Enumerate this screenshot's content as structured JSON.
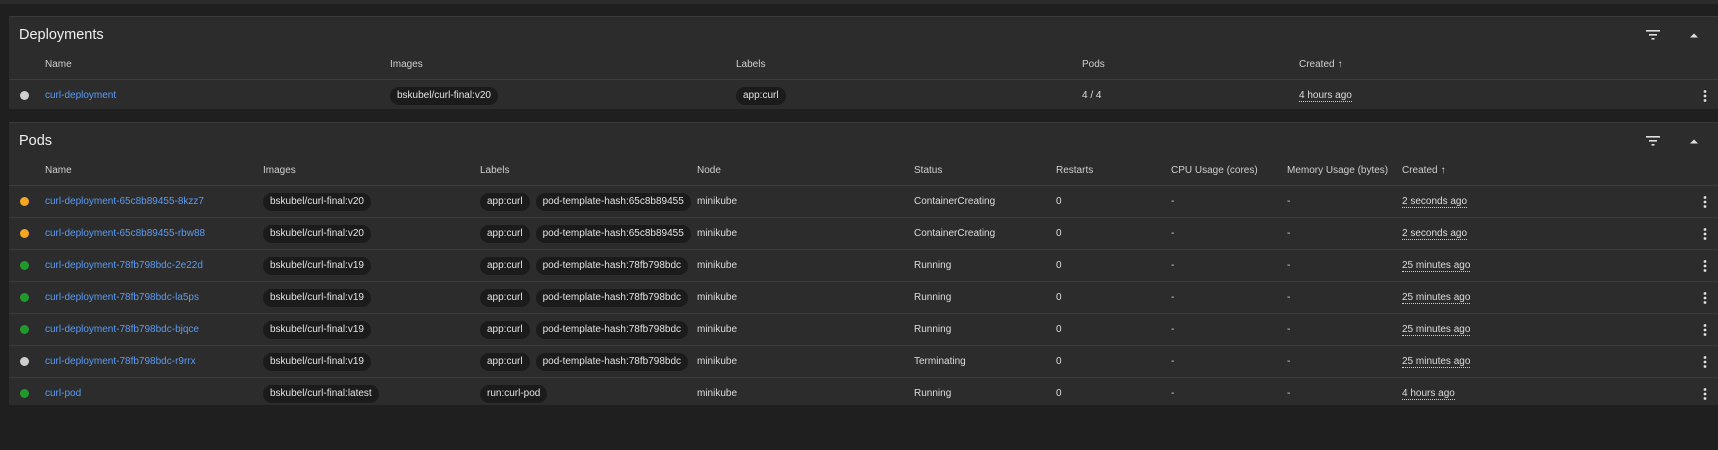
{
  "colors": {
    "running": "#1f9a2c",
    "pending": "#f5a623",
    "terminating": "#cfcfcf",
    "deployment_status": "#cfcfcf",
    "link": "#5b9bf2"
  },
  "deployments": {
    "title": "Deployments",
    "filter_icon": "filter-list-icon",
    "collapse_icon": "chevron-up-icon",
    "columns": {
      "name": "Name",
      "images": "Images",
      "labels": "Labels",
      "pods": "Pods",
      "created": "Created"
    },
    "rows": [
      {
        "status": "deployment_status",
        "name": "curl-deployment",
        "image": "bskubel/curl-final:v20",
        "labels": [
          "app:curl"
        ],
        "pods": "4 / 4",
        "created": "4 hours ago"
      }
    ]
  },
  "pods": {
    "title": "Pods",
    "filter_icon": "filter-list-icon",
    "collapse_icon": "chevron-up-icon",
    "columns": {
      "name": "Name",
      "images": "Images",
      "labels": "Labels",
      "node": "Node",
      "status": "Status",
      "restarts": "Restarts",
      "cpu": "CPU Usage (cores)",
      "memory": "Memory Usage (bytes)",
      "created": "Created"
    },
    "rows": [
      {
        "dot": "pending",
        "name": "curl-deployment-65c8b89455-8kzz7",
        "image": "bskubel/curl-final:v20",
        "labels": [
          "app:curl",
          "pod-template-hash:65c8b89455"
        ],
        "node": "minikube",
        "status": "ContainerCreating",
        "restarts": "0",
        "cpu": "-",
        "memory": "-",
        "created": "2 seconds ago"
      },
      {
        "dot": "pending",
        "name": "curl-deployment-65c8b89455-rbw88",
        "image": "bskubel/curl-final:v20",
        "labels": [
          "app:curl",
          "pod-template-hash:65c8b89455"
        ],
        "node": "minikube",
        "status": "ContainerCreating",
        "restarts": "0",
        "cpu": "-",
        "memory": "-",
        "created": "2 seconds ago"
      },
      {
        "dot": "running",
        "name": "curl-deployment-78fb798bdc-2e22d",
        "image": "bskubel/curl-final:v19",
        "labels": [
          "app:curl",
          "pod-template-hash:78fb798bdc"
        ],
        "node": "minikube",
        "status": "Running",
        "restarts": "0",
        "cpu": "-",
        "memory": "-",
        "created": "25 minutes ago"
      },
      {
        "dot": "running",
        "name": "curl-deployment-78fb798bdc-la5ps",
        "image": "bskubel/curl-final:v19",
        "labels": [
          "app:curl",
          "pod-template-hash:78fb798bdc"
        ],
        "node": "minikube",
        "status": "Running",
        "restarts": "0",
        "cpu": "-",
        "memory": "-",
        "created": "25 minutes ago"
      },
      {
        "dot": "running",
        "name": "curl-deployment-78fb798bdc-bjqce",
        "image": "bskubel/curl-final:v19",
        "labels": [
          "app:curl",
          "pod-template-hash:78fb798bdc"
        ],
        "node": "minikube",
        "status": "Running",
        "restarts": "0",
        "cpu": "-",
        "memory": "-",
        "created": "25 minutes ago"
      },
      {
        "dot": "terminating",
        "name": "curl-deployment-78fb798bdc-r9rrx",
        "image": "bskubel/curl-final:v19",
        "labels": [
          "app:curl",
          "pod-template-hash:78fb798bdc"
        ],
        "node": "minikube",
        "status": "Terminating",
        "restarts": "0",
        "cpu": "-",
        "memory": "-",
        "created": "25 minutes ago"
      },
      {
        "dot": "running",
        "name": "curl-pod",
        "image": "bskubel/curl-final:latest",
        "labels": [
          "run:curl-pod"
        ],
        "node": "minikube",
        "status": "Running",
        "restarts": "0",
        "cpu": "-",
        "memory": "-",
        "created": "4 hours ago"
      }
    ]
  }
}
